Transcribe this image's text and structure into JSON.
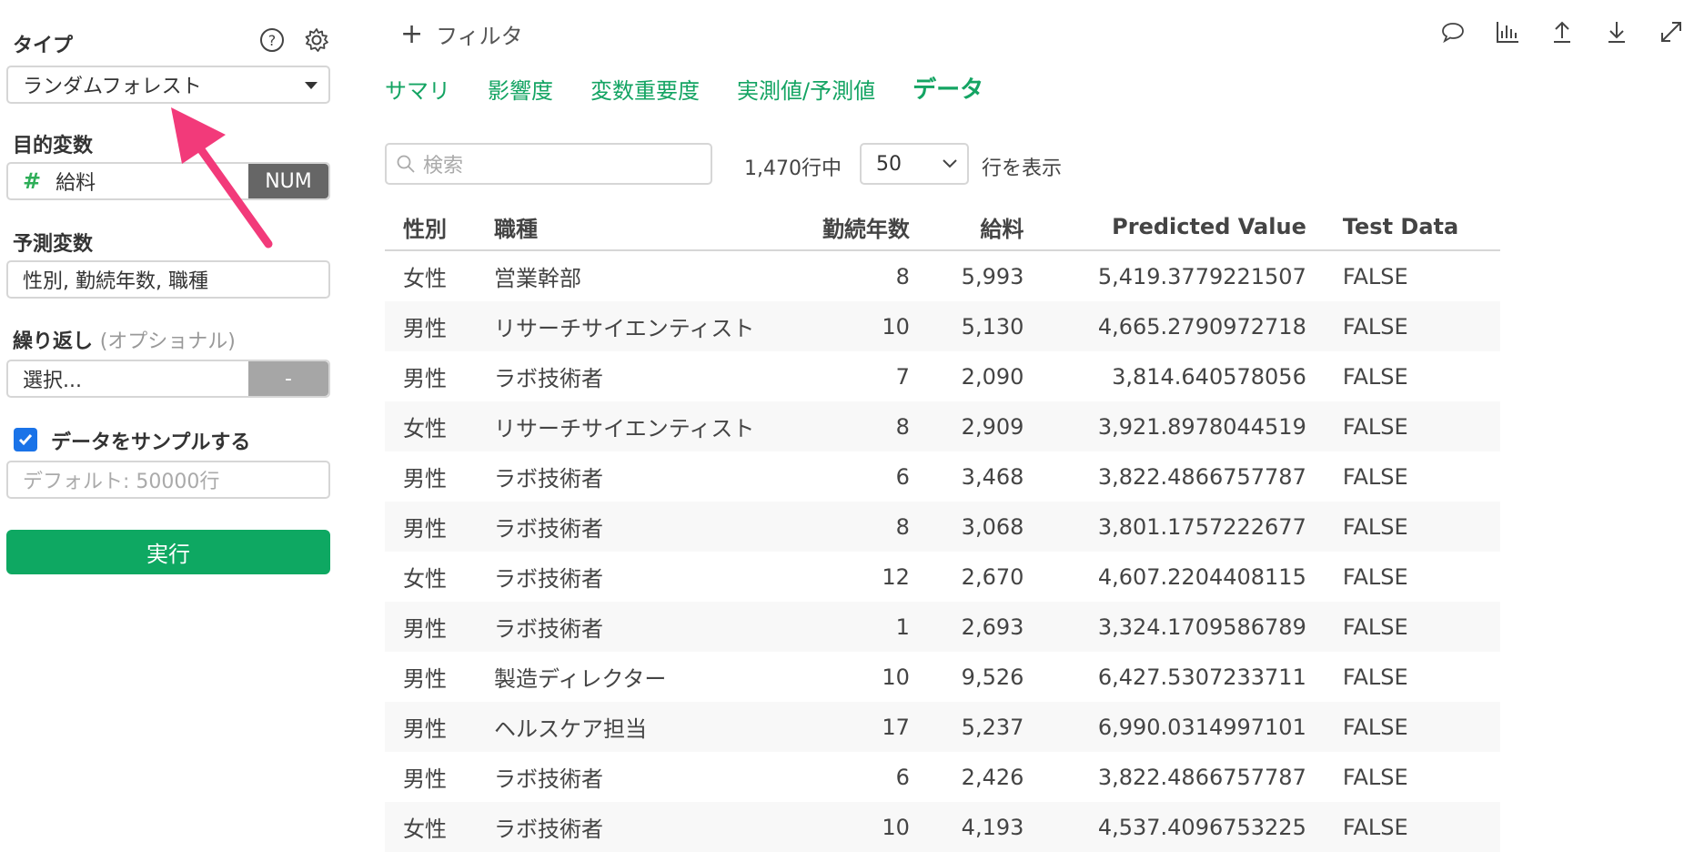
{
  "sidebar": {
    "type_label": "タイプ",
    "type_value": "ランダムフォレスト",
    "target_label": "目的変数",
    "target_value": "給料",
    "target_tag": "NUM",
    "predictor_label": "予測変数",
    "predictor_value": "性別, 勤続年数, 職種",
    "repeat_label": "繰り返し",
    "repeat_optional": "(オプショナル)",
    "repeat_value": "選択...",
    "repeat_tag": "-",
    "sample_label": "データをサンプルする",
    "sample_placeholder": "デフォルト: 50000行",
    "run_label": "実行"
  },
  "main": {
    "filter_label": "フィルタ",
    "tabs": [
      {
        "label": "サマリ"
      },
      {
        "label": "影響度"
      },
      {
        "label": "変数重要度"
      },
      {
        "label": "実測値/予測値"
      },
      {
        "label": "データ"
      }
    ],
    "search_placeholder": "検索",
    "row_count": "1,470行中",
    "page_size": "50",
    "show_rows": "行を表示"
  },
  "table": {
    "headers": [
      "性別",
      "職種",
      "勤続年数",
      "給料",
      "Predicted Value",
      "Test Data"
    ],
    "rows": [
      [
        "女性",
        "営業幹部",
        "8",
        "5,993",
        "5,419.3779221507",
        "FALSE"
      ],
      [
        "男性",
        "リサーチサイエンティスト",
        "10",
        "5,130",
        "4,665.2790972718",
        "FALSE"
      ],
      [
        "男性",
        "ラボ技術者",
        "7",
        "2,090",
        "3,814.640578056",
        "FALSE"
      ],
      [
        "女性",
        "リサーチサイエンティスト",
        "8",
        "2,909",
        "3,921.8978044519",
        "FALSE"
      ],
      [
        "男性",
        "ラボ技術者",
        "6",
        "3,468",
        "3,822.4866757787",
        "FALSE"
      ],
      [
        "男性",
        "ラボ技術者",
        "8",
        "3,068",
        "3,801.1757222677",
        "FALSE"
      ],
      [
        "女性",
        "ラボ技術者",
        "12",
        "2,670",
        "4,607.2204408115",
        "FALSE"
      ],
      [
        "男性",
        "ラボ技術者",
        "1",
        "2,693",
        "3,324.1709586789",
        "FALSE"
      ],
      [
        "男性",
        "製造ディレクター",
        "10",
        "9,526",
        "6,427.5307233711",
        "FALSE"
      ],
      [
        "男性",
        "ヘルスケア担当",
        "17",
        "5,237",
        "6,990.0314997101",
        "FALSE"
      ],
      [
        "男性",
        "ラボ技術者",
        "6",
        "2,426",
        "3,822.4866757787",
        "FALSE"
      ],
      [
        "女性",
        "ラボ技術者",
        "10",
        "4,193",
        "4,537.4096753225",
        "FALSE"
      ]
    ]
  },
  "colors": {
    "accent": "#14a463",
    "run_button": "#0ea862",
    "arrow": "#f23a7a",
    "checkbox": "#1a73e8"
  }
}
